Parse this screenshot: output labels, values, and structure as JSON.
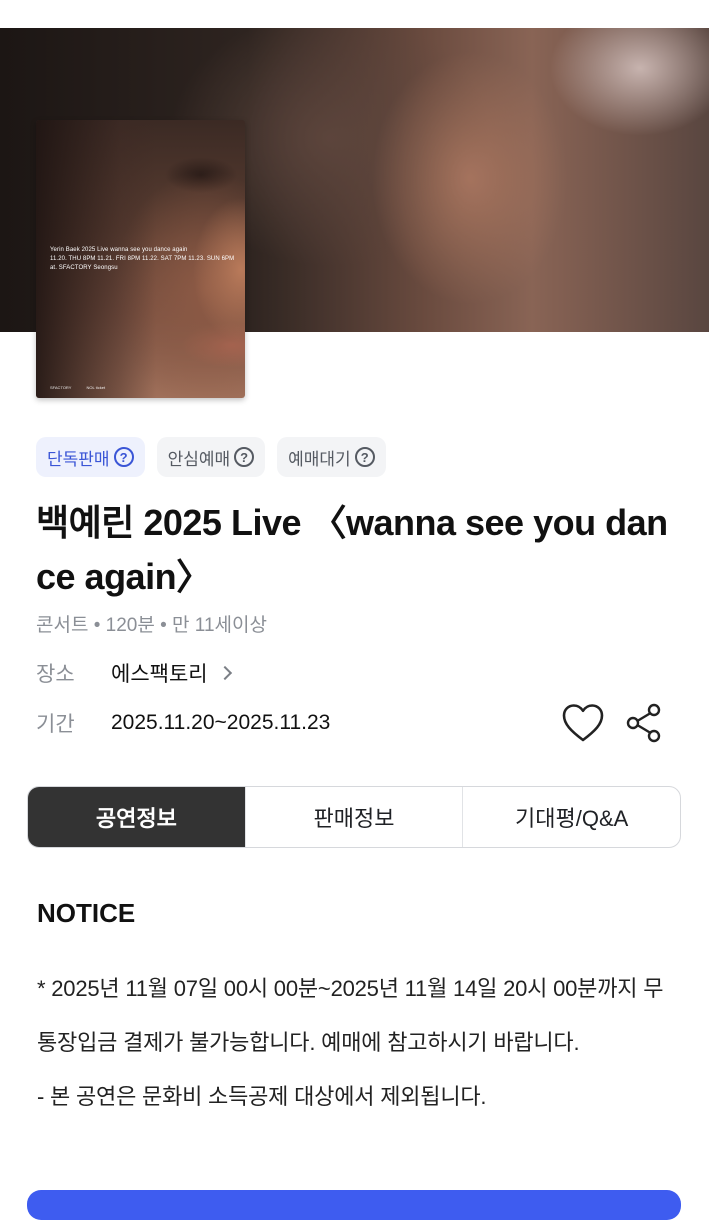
{
  "poster": {
    "line1": "Yerin Baek 2025 Live    wanna see you dance again",
    "line2": "11.20. THU 8PM    11.21. FRI 8PM    11.22. SAT 7PM    11.23. SUN 6PM",
    "line3": "at. SFACTORY Seongsu",
    "logo_left": "SFACTORY",
    "logo_right": "NOL ticket",
    "ghost_text": "Y\n11\nat."
  },
  "badges": [
    {
      "label": "단독판매",
      "icon": "question-circle-icon"
    },
    {
      "label": "안심예매",
      "icon": "question-circle-icon"
    },
    {
      "label": "예매대기",
      "icon": "question-circle-icon"
    }
  ],
  "event": {
    "title": "백예린 2025 Live 〈wanna see you dance again〉",
    "meta": "콘서트 • 120분 • 만 11세이상",
    "venue_label": "장소",
    "venue_value": "에스팩토리",
    "period_label": "기간",
    "period_value": "2025.11.20~2025.11.23"
  },
  "tabs": [
    {
      "label": "공연정보",
      "active": true
    },
    {
      "label": "판매정보",
      "active": false
    },
    {
      "label": "기대평/Q&A",
      "active": false
    }
  ],
  "notice": {
    "title": "NOTICE",
    "paragraph1": "* 2025년 11월 07일 00시 00분~2025년 11월 14일 20시 00분까지 무통장입금 결제가 불가능합니다. 예매에 참고하시기 바랍니다.",
    "paragraph2": "- 본 공연은 문화비 소득공제 대상에서 제외됩니다."
  },
  "colors": {
    "accent": "#3a55d6",
    "active_tab": "#333333",
    "bottom_button": "#3e5cf0"
  }
}
